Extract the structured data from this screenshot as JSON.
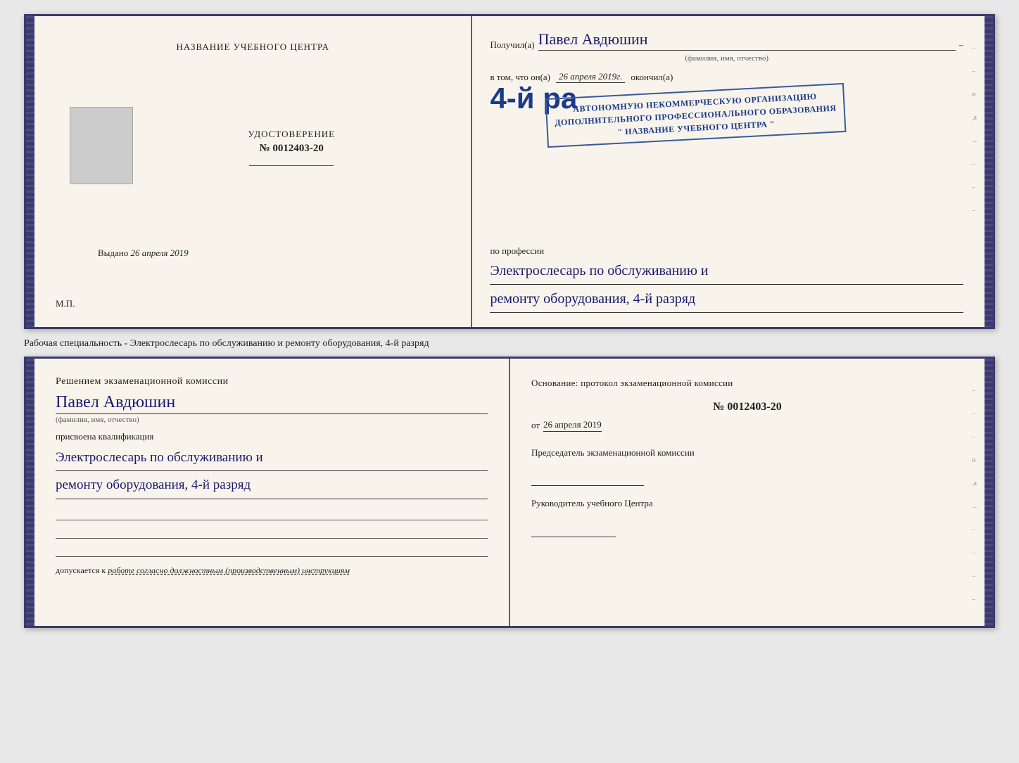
{
  "topDoc": {
    "leftPage": {
      "title": "НАЗВАНИЕ УЧЕБНОГО ЦЕНТРА",
      "docLabel": "УДОСТОВЕРЕНИЕ",
      "docNumber": "№ 0012403-20",
      "issuedLabel": "Выдано",
      "issuedDate": "26 апреля 2019",
      "mpLabel": "М.П."
    },
    "rightPage": {
      "receivedLabel": "Получил(а)",
      "personName": "Павел Авдюшин",
      "nameSubtitle": "(фамилия, имя, отчество)",
      "vtomLabel": "в том, что он(а)",
      "date": "26 апреля 2019г.",
      "okonchilLabel": "окончил(а)",
      "bigText": "4-й ра",
      "orgLine1": "АВТОНОМНУЮ НЕКОММЕРЧЕСКУЮ ОРГАНИЗАЦИЮ",
      "orgLine2": "ДОПОЛНИТЕЛЬНОГО ПРОФЕССИОНАЛЬНОГО ОБРАЗОВАНИЯ",
      "orgLine3": "\" НАЗВАНИЕ УЧЕБНОГО ЦЕНТРА \"",
      "poProfessii": "по профессии",
      "profession1": "Электрослесарь по обслуживанию и",
      "profession2": "ремонту оборудования, 4-й разряд"
    }
  },
  "middleText": "Рабочая специальность - Электрослесарь по обслуживанию и ремонту оборудования, 4-й\nразряд",
  "bottomDoc": {
    "leftPage": {
      "decisionLabel": "Решением экзаменационной комиссии",
      "personName": "Павел Авдюшин",
      "nameSubtitle": "(фамилия, имя, отчество)",
      "prisvoenaLabel": "присвоена квалификация",
      "qual1": "Электрослесарь по обслуживанию и",
      "qual2": "ремонту оборудования, 4-й разряд",
      "dopuskaetsyaLabel": "допускается к",
      "dopuskaetsyaText": "работе согласно должностным (производственным) инструкциям"
    },
    "rightPage": {
      "osnovLabel": "Основание: протокол экзаменационной комиссии",
      "protocolNumber": "№ 0012403-20",
      "otLabel": "от",
      "otDate": "26 апреля 2019",
      "chairmanLabel": "Председатель экзаменационной комиссии",
      "directorLabel": "Руководитель учебного Центра"
    }
  },
  "sideDashes": [
    "-",
    "–",
    "и",
    ",а",
    "←",
    "–",
    "–",
    "–"
  ]
}
